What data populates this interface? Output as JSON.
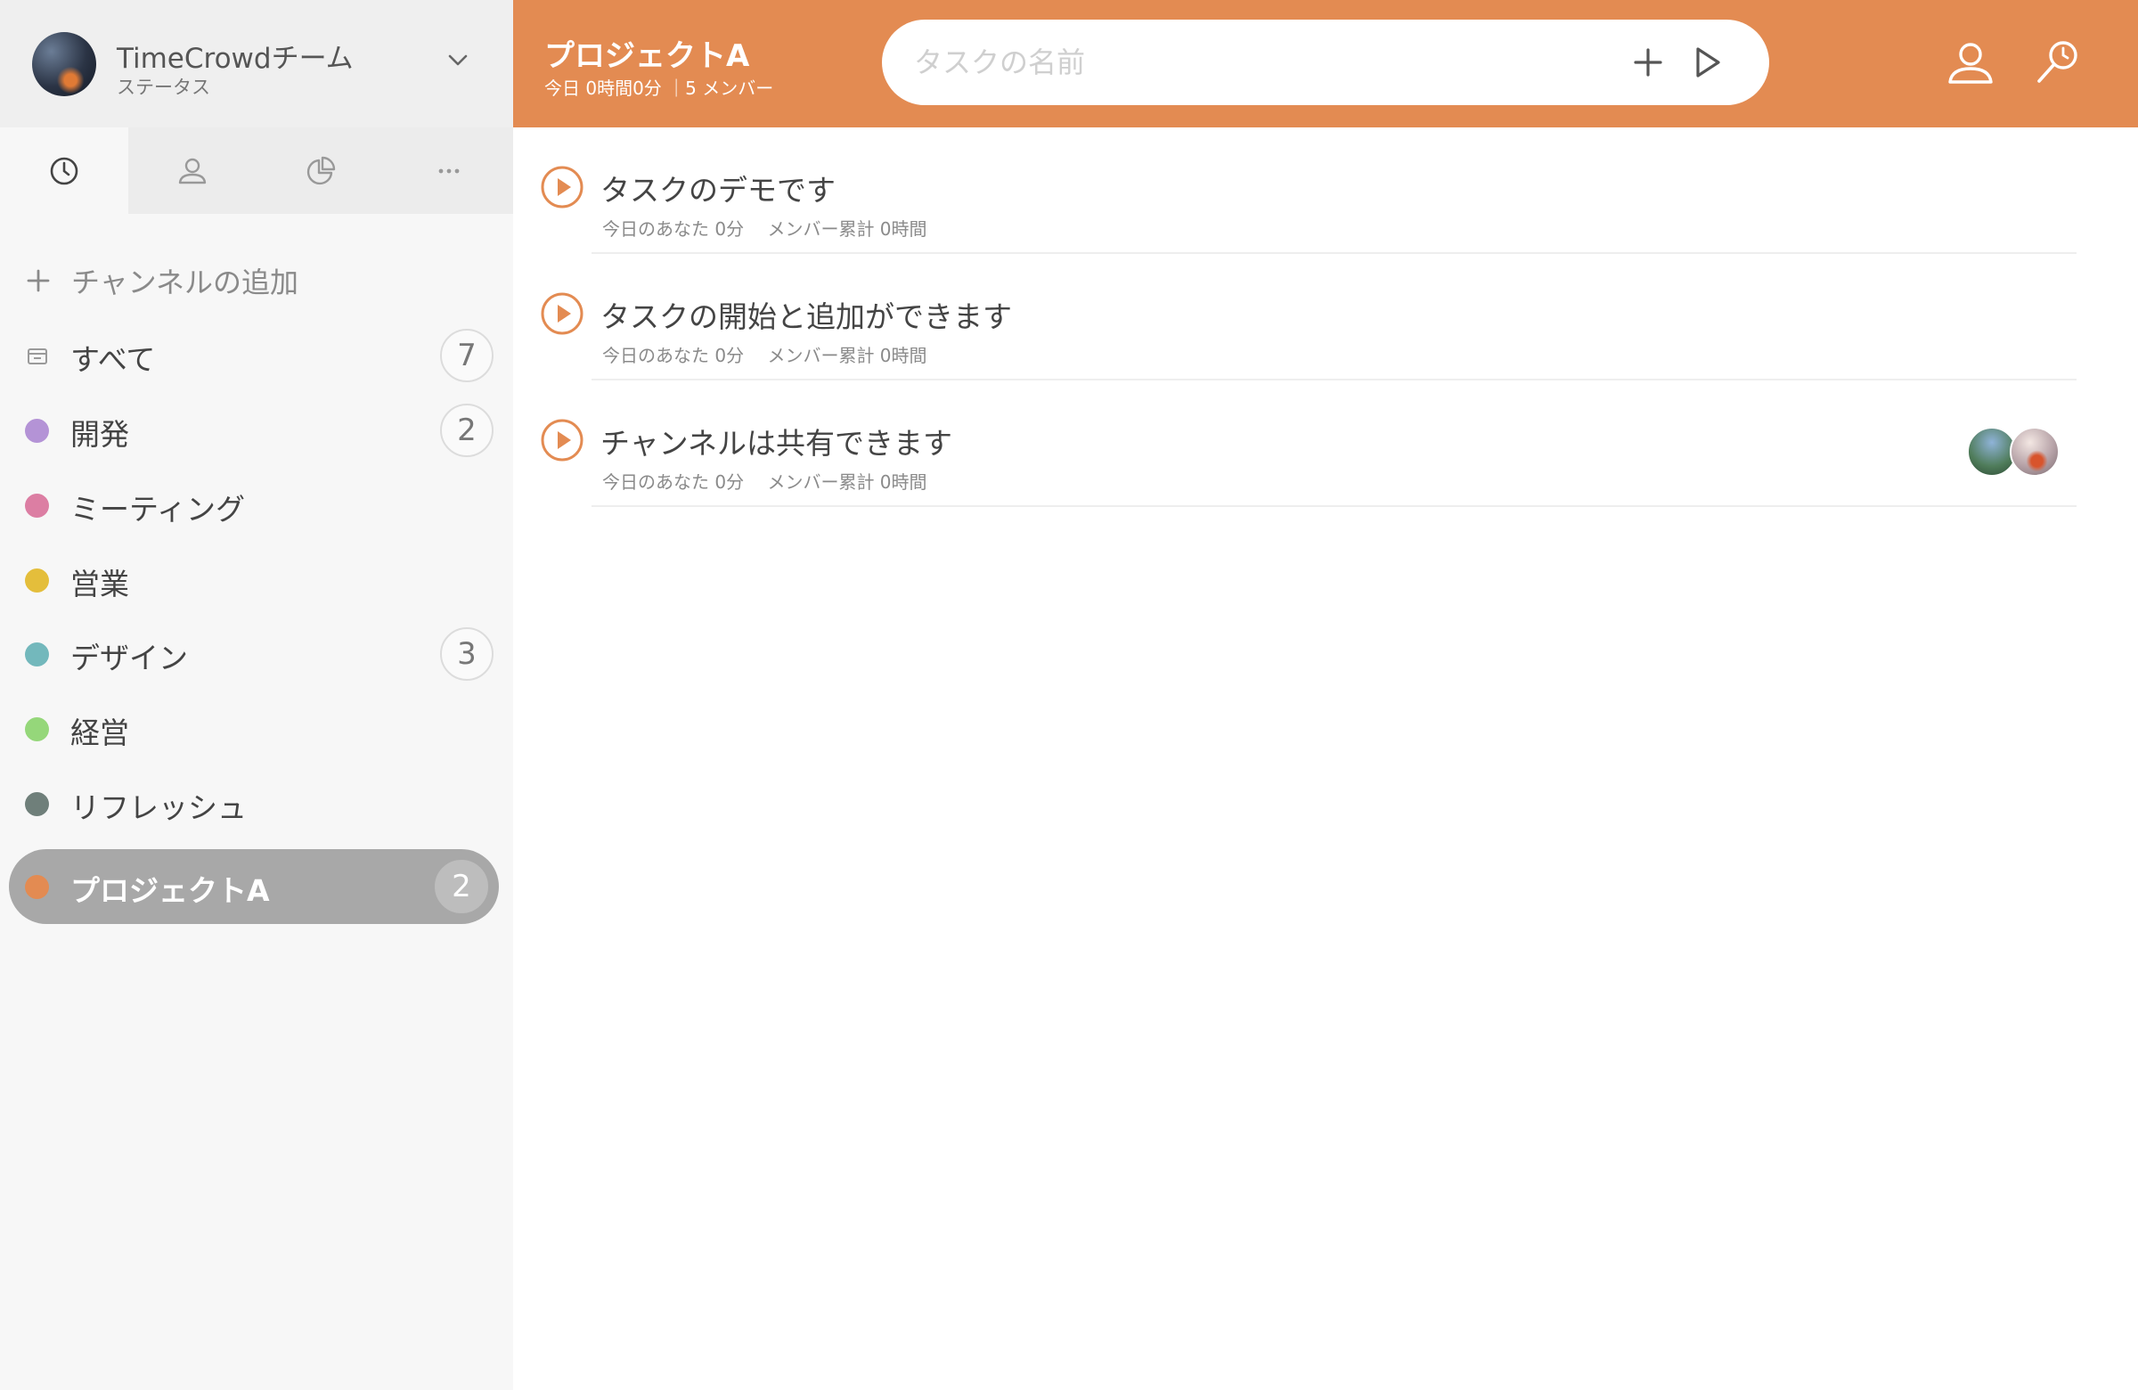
{
  "team": {
    "name": "TimeCrowdチーム",
    "status": "ステータス"
  },
  "tabs": [
    {
      "icon": "clock-icon",
      "active": true
    },
    {
      "icon": "user-icon",
      "active": false
    },
    {
      "icon": "pie-chart-icon",
      "active": false
    },
    {
      "icon": "more-icon",
      "active": false
    }
  ],
  "sidebar": {
    "add_channel_label": "チャンネルの追加",
    "channels": [
      {
        "label": "すべて",
        "count": "7",
        "color": null,
        "icon": "inbox-icon"
      },
      {
        "label": "開発",
        "count": "2",
        "color": "#b493d6"
      },
      {
        "label": "ミーティング",
        "count": "",
        "color": "#dc7ea3"
      },
      {
        "label": "営業",
        "count": "",
        "color": "#e4be3b"
      },
      {
        "label": "デザイン",
        "count": "3",
        "color": "#73b8bc"
      },
      {
        "label": "経営",
        "count": "",
        "color": "#95d77a"
      },
      {
        "label": "リフレッシュ",
        "count": "",
        "color": "#6f7f7a"
      },
      {
        "label": "プロジェクトA",
        "count": "2",
        "color": "#e38b52",
        "active": true
      }
    ]
  },
  "header": {
    "project_title": "プロジェクトA",
    "project_subtitle": "今日 0時間0分 ｜5 メンバー",
    "search_placeholder": "タスクの名前",
    "accent_color": "#e38b52"
  },
  "tasks": [
    {
      "name": "タスクのデモです",
      "you_today": "今日のあなた 0分",
      "member_total": "メンバー累計 0時間",
      "has_avatars": false
    },
    {
      "name": "タスクの開始と追加ができます",
      "you_today": "今日のあなた 0分",
      "member_total": "メンバー累計 0時間",
      "has_avatars": false
    },
    {
      "name": "チャンネルは共有できます",
      "you_today": "今日のあなた 0分",
      "member_total": "メンバー累計 0時間",
      "has_avatars": true
    }
  ]
}
